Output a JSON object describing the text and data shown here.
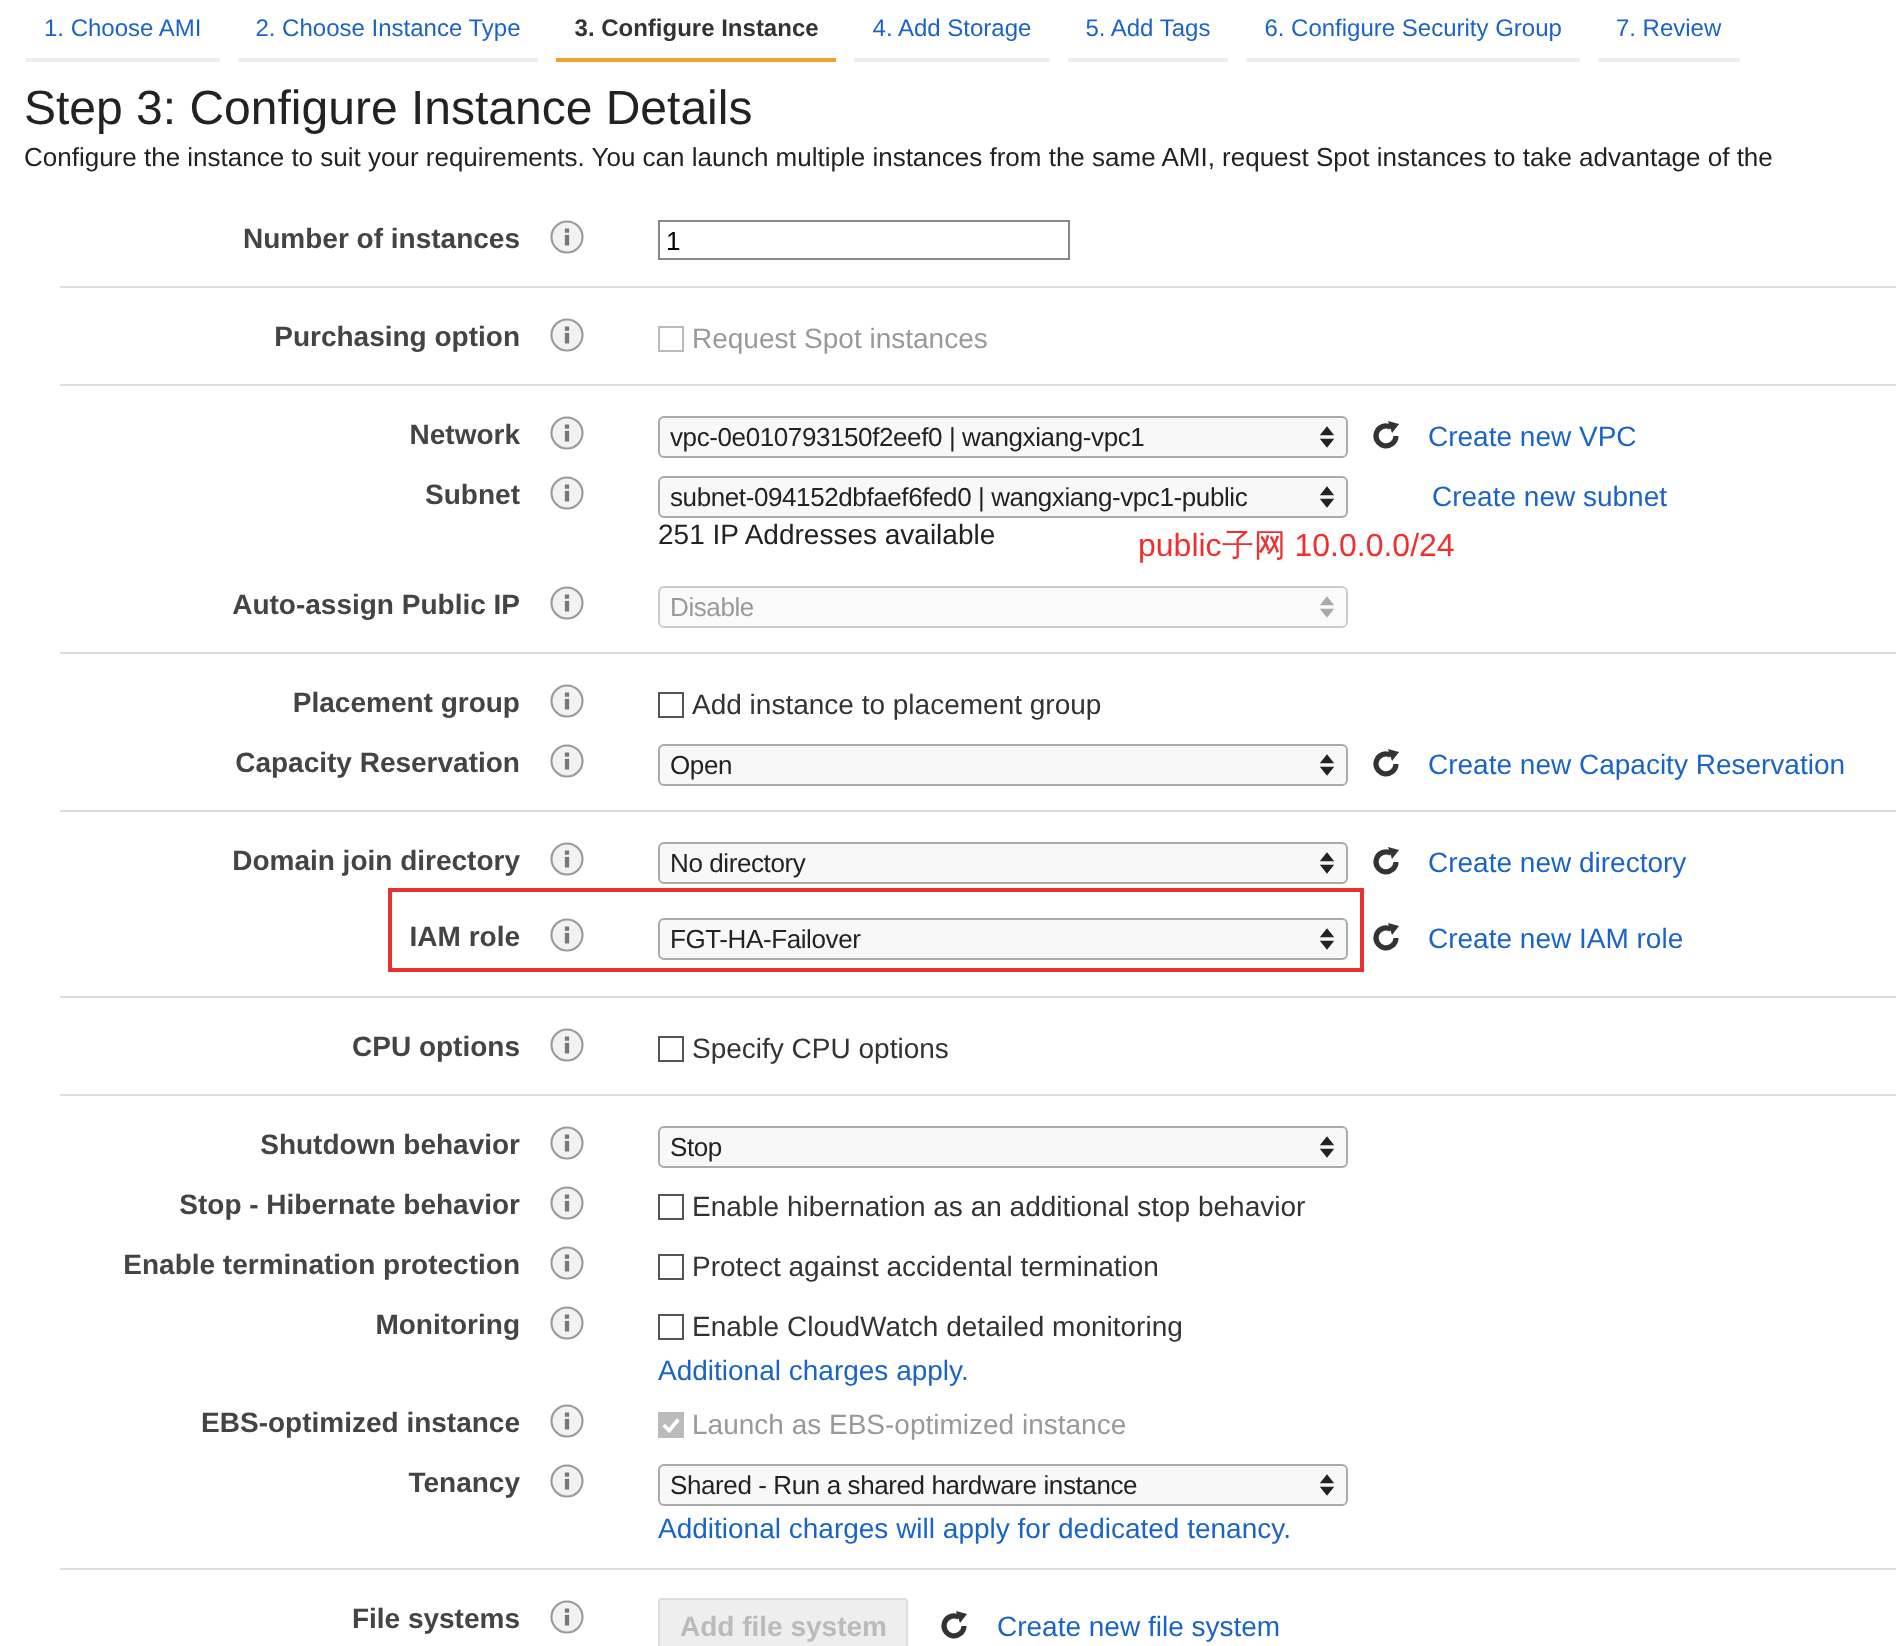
{
  "tabs": [
    {
      "label": "1. Choose AMI",
      "selected": false
    },
    {
      "label": "2. Choose Instance Type",
      "selected": false
    },
    {
      "label": "3. Configure Instance",
      "selected": true
    },
    {
      "label": "4. Add Storage",
      "selected": false
    },
    {
      "label": "5. Add Tags",
      "selected": false
    },
    {
      "label": "6. Configure Security Group",
      "selected": false
    },
    {
      "label": "7. Review",
      "selected": false
    }
  ],
  "heading": "Step 3: Configure Instance Details",
  "description": "Configure the instance to suit your requirements. You can launch multiple instances from the same AMI, request Spot instances to take advantage of the",
  "sections": [
    {
      "rows": [
        {
          "kind": "text",
          "label": "Number of instances",
          "value": "1"
        }
      ]
    },
    {
      "rows": [
        {
          "kind": "checkbox",
          "label": "Purchasing option",
          "value": "Request Spot instances",
          "checked": false,
          "disabled": true
        }
      ]
    },
    {
      "rows": [
        {
          "kind": "select",
          "label": "Network",
          "value": "vpc-0e010793150f2eef0 | wangxiang-vpc1",
          "refresh": true,
          "link": "Create new VPC"
        },
        {
          "kind": "select",
          "label": "Subnet",
          "value": "subnet-094152dbfaef6fed0 | wangxiang-vpc1-public",
          "refresh": false,
          "link": "Create new subnet",
          "sub": "251 IP Addresses available",
          "annotation": "public子网 10.0.0.0/24"
        },
        {
          "kind": "select",
          "label": "Auto-assign Public IP",
          "value": "Disable",
          "disabled": true
        }
      ]
    },
    {
      "rows": [
        {
          "kind": "checkbox",
          "label": "Placement group",
          "value": "Add instance to placement group",
          "checked": false
        },
        {
          "kind": "select",
          "label": "Capacity Reservation",
          "value": "Open",
          "refresh": true,
          "link": "Create new Capacity Reservation"
        }
      ]
    },
    {
      "rows": [
        {
          "kind": "select",
          "label": "Domain join directory",
          "value": "No directory",
          "refresh": true,
          "link": "Create new directory"
        },
        {
          "kind": "select",
          "label": "IAM role",
          "value": "FGT-HA-Failover",
          "refresh": true,
          "link": "Create new IAM role",
          "highlighted": true
        }
      ]
    },
    {
      "rows": [
        {
          "kind": "checkbox",
          "label": "CPU options",
          "value": "Specify CPU options",
          "checked": false
        }
      ]
    },
    {
      "rows": [
        {
          "kind": "select",
          "label": "Shutdown behavior",
          "value": "Stop"
        },
        {
          "kind": "checkbox",
          "label": "Stop - Hibernate behavior",
          "value": "Enable hibernation as an additional stop behavior",
          "checked": false
        },
        {
          "kind": "checkbox",
          "label": "Enable termination protection",
          "value": "Protect against accidental termination",
          "checked": false
        },
        {
          "kind": "checkbox",
          "label": "Monitoring",
          "value": "Enable CloudWatch detailed monitoring",
          "checked": false,
          "note": "Additional charges apply."
        },
        {
          "kind": "checkbox",
          "label": "EBS-optimized instance",
          "value": "Launch as EBS-optimized instance",
          "checked": true,
          "disabled": true
        },
        {
          "kind": "select",
          "label": "Tenancy",
          "value": "Shared - Run a shared hardware instance",
          "note": "Additional charges will apply for dedicated tenancy."
        }
      ]
    },
    {
      "rows": [
        {
          "kind": "button",
          "label": "File systems",
          "value": "Add file system",
          "disabled": true,
          "refresh": true,
          "link": "Create new file system"
        }
      ]
    }
  ]
}
